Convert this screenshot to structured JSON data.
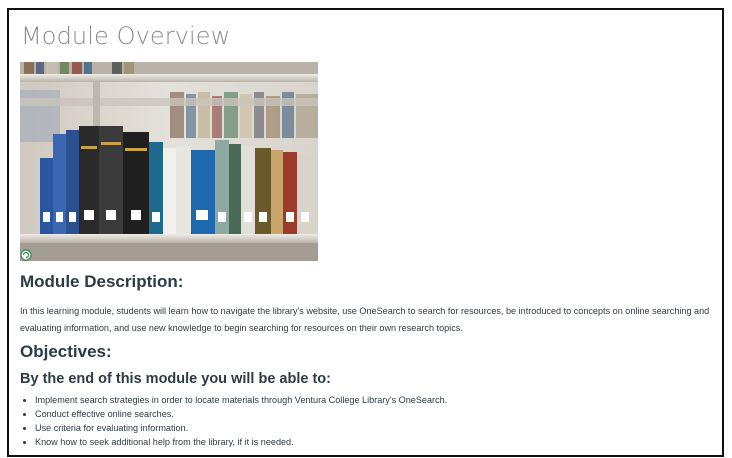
{
  "page": {
    "title": "Module Overview"
  },
  "image": {
    "alt": "library-books-on-shelf"
  },
  "description": {
    "heading": "Module Description:",
    "text": "In this learning module, students will learn how to navigate the library's website, use OneSearch to search for resources, be introduced to concepts on online searching and evaluating information, and use new knowledge to begin searching for resources on their own research topics."
  },
  "objectives": {
    "heading": "Objectives:",
    "subheading": "By the end of this module you will be able to:",
    "items": [
      "Implement search strategies in order to locate materials through Ventura College Library's OneSearch.",
      "Conduct effective online searches.",
      "Use criteria for evaluating information.",
      "Know how to seek additional help from the library, if it is needed."
    ]
  },
  "colors": {
    "title_gray": "#8a8a8a",
    "text_dark": "#2d3b45",
    "border": "#111111"
  },
  "icons": {
    "image_badge": "refresh-icon"
  }
}
